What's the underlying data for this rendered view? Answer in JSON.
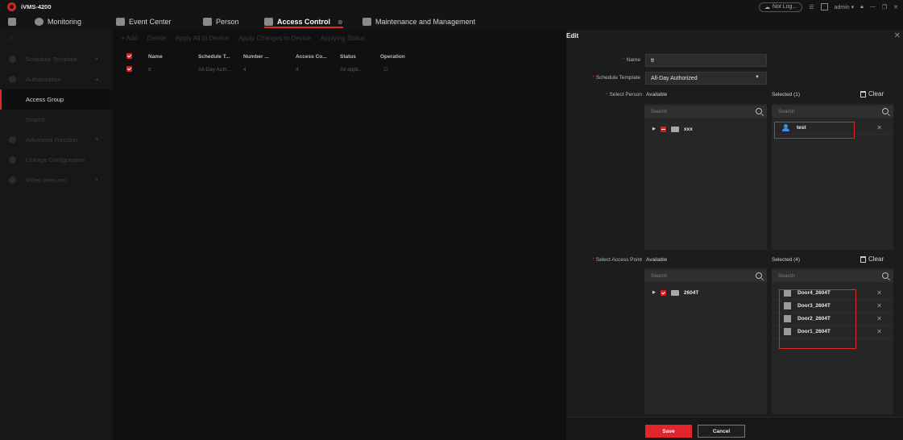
{
  "app": {
    "name": "iVMS-4200"
  },
  "titlebar": {
    "cloud": "Not Log...",
    "user": "admin ▾"
  },
  "tabs": [
    {
      "label": "Monitoring"
    },
    {
      "label": "Event Center"
    },
    {
      "label": "Person"
    },
    {
      "label": "Access Control",
      "active": true
    },
    {
      "label": "Maintenance and Management"
    }
  ],
  "sidebar": {
    "items": [
      {
        "label": "Schedule Template"
      },
      {
        "label": "Authorization"
      },
      {
        "label": "Access Group"
      },
      {
        "label": "Search"
      },
      {
        "label": "Advanced Function"
      },
      {
        "label": "Linkage Configuration"
      },
      {
        "label": "Video Intercom"
      }
    ]
  },
  "toolbar": {
    "add": "+ Add",
    "delete": "Delete",
    "apply_all": "Apply All to Device",
    "apply_changes": "Apply Changes to Device",
    "applying_status": "Applying Status"
  },
  "table": {
    "headers": [
      "Name",
      "Schedule T...",
      "Number ...",
      "Access Co...",
      "Status",
      "Operation"
    ],
    "rows": [
      {
        "name": "tt",
        "schedule": "All-Day Auth...",
        "number": "4",
        "access": "4",
        "status": "All appli..."
      }
    ]
  },
  "edit": {
    "title": "Edit",
    "name_label": "Name",
    "name_value": "tt",
    "schedule_label": "Schedule Template",
    "schedule_value": "All-Day Authorized",
    "person_label": "Select Person",
    "access_label": "Select Access Point",
    "available": "Available",
    "selected_person": "Selected (1)",
    "selected_access": "Selected (4)",
    "clear": "Clear",
    "search_placeholder": "Search",
    "person_tree": {
      "label": "xxx"
    },
    "person_selected": [
      "test"
    ],
    "access_tree": {
      "label": "2604T"
    },
    "access_selected": [
      "Door4_2604T",
      "Door3_2604T",
      "Door2_2604T",
      "Door1_2604T"
    ],
    "save": "Save",
    "cancel": "Cancel"
  },
  "colors": {
    "accent": "#e0262b",
    "panel": "#1c1c1c",
    "background": "#101010"
  }
}
